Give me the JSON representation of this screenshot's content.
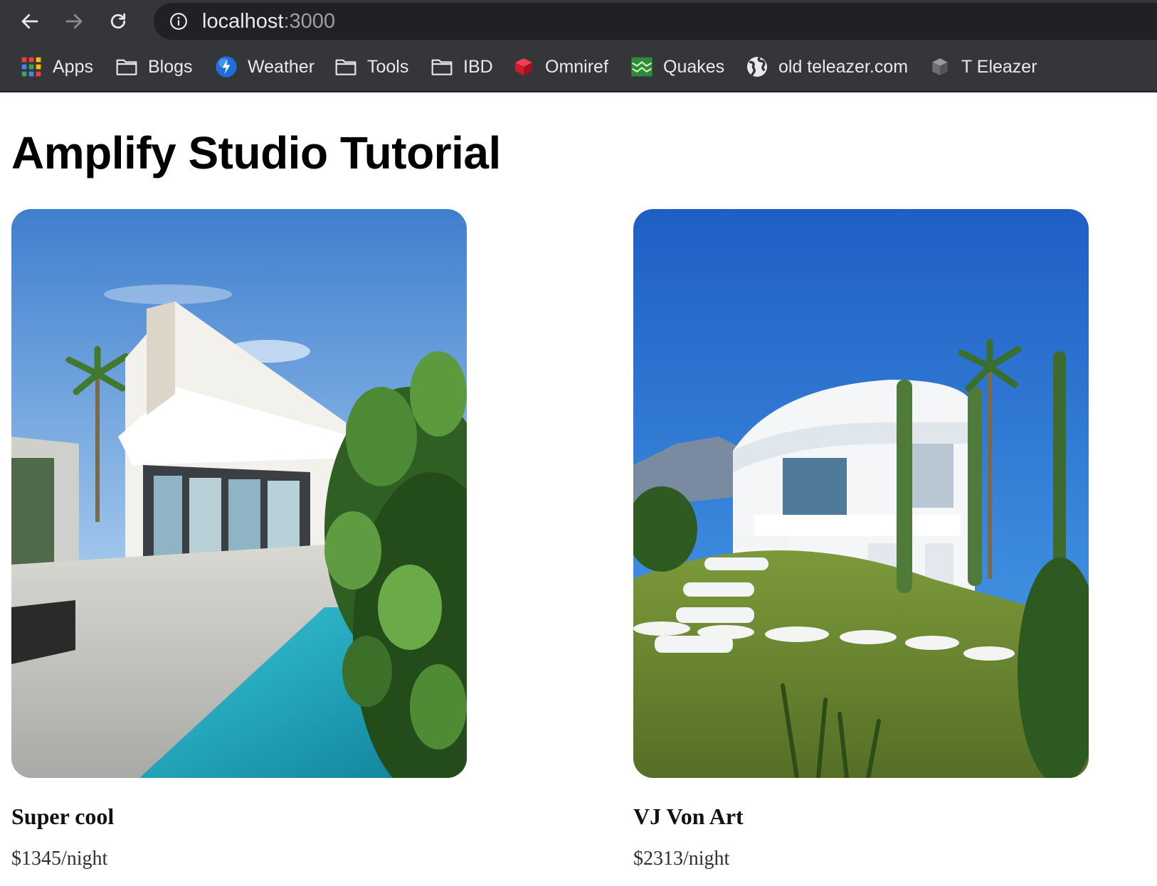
{
  "browser": {
    "url_host": "localhost",
    "url_port": ":3000",
    "nav": {
      "back_icon": "arrow-left-icon",
      "forward_icon": "arrow-right-icon",
      "reload_icon": "reload-icon",
      "info_icon": "info-icon"
    },
    "bookmarks": [
      {
        "label": "Apps",
        "icon": "apps-grid-icon"
      },
      {
        "label": "Blogs",
        "icon": "folder-icon"
      },
      {
        "label": "Weather",
        "icon": "weather-globe-icon"
      },
      {
        "label": "Tools",
        "icon": "folder-icon"
      },
      {
        "label": "IBD",
        "icon": "folder-icon"
      },
      {
        "label": "Omniref",
        "icon": "red-cube-icon"
      },
      {
        "label": "Quakes",
        "icon": "quakes-chart-icon"
      },
      {
        "label": "old teleazer.com",
        "icon": "globe-icon"
      },
      {
        "label": "T Eleazer",
        "icon": "gray-cube-icon"
      }
    ]
  },
  "main": {
    "title": "Amplify Studio Tutorial",
    "listings": [
      {
        "name": "Super cool",
        "price": "$1345/night"
      },
      {
        "name": "VJ Von Art",
        "price": "$2313/night"
      }
    ]
  },
  "colors": {
    "chrome_bg": "#35363a",
    "omnibox_bg": "#202124",
    "chrome_text": "#e8eaed"
  }
}
